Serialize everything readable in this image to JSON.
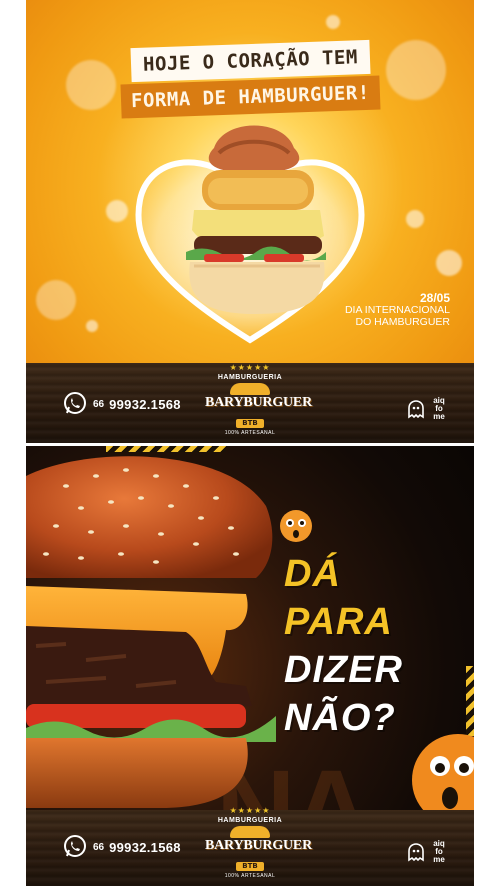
{
  "post1": {
    "headline_line1": "HOJE O CORAÇÃO TEM",
    "headline_line2": "FORMA DE HAMBURGUER!",
    "date": "28/05",
    "event_line1": "DIA INTERNACIONAL",
    "event_line2": "DO HAMBURGUER",
    "colors": {
      "background": "#f8b020",
      "headline_bar_1": "#fffaf2",
      "headline_bar_2": "#d97c12",
      "wood": "#2a1a0e"
    }
  },
  "post2": {
    "question_line1": "DÁ",
    "question_line2": "PARA",
    "question_line3": "DIZER",
    "question_line4": "NÃO?",
    "background_text": "NA",
    "colors": {
      "background": "#120a06",
      "accent_yellow": "#f4c226",
      "text_white": "#ffffff"
    }
  },
  "footer": {
    "phone_area_code": "66",
    "phone_number": "99932.1568",
    "brand_arc": "HAMBURGUERIA",
    "brand_name": "BARYBURGUER",
    "brand_sub": "BTB",
    "brand_tagline": "100% ARTESANAL",
    "delivery_line1": "aiq",
    "delivery_line2": "fo",
    "delivery_line3": "me",
    "icons": [
      "whatsapp-icon",
      "brand-logo",
      "aiqfome-icon"
    ]
  }
}
